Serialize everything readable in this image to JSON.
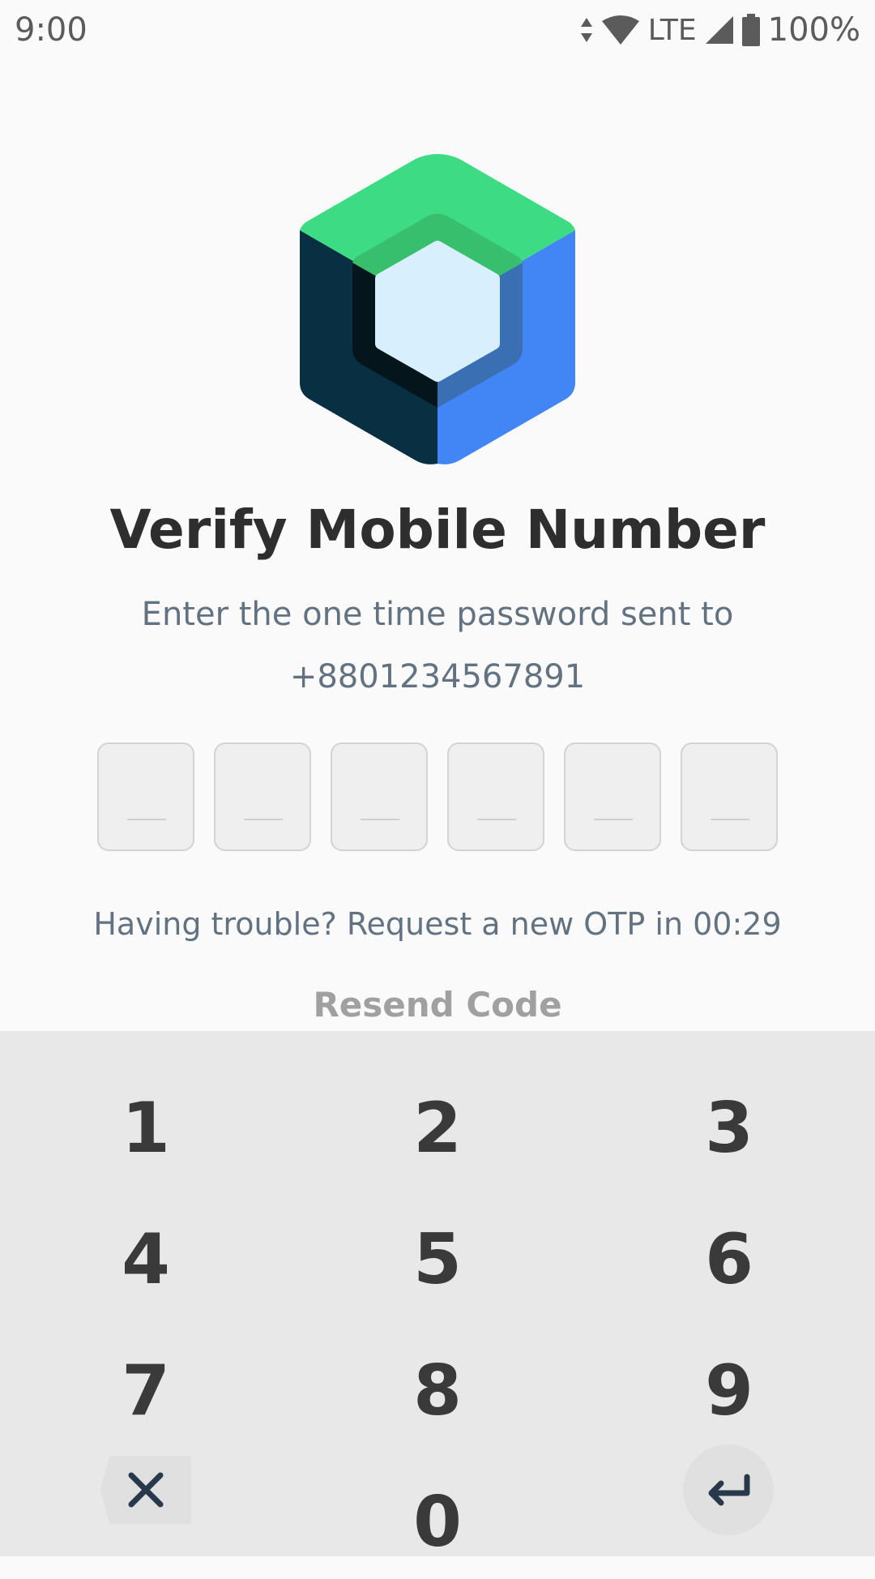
{
  "status_bar": {
    "time": "9:00",
    "network": "LTE",
    "battery": "100%",
    "icons": [
      "data-arrows-icon",
      "wifi-icon",
      "cell-signal-icon",
      "battery-icon"
    ]
  },
  "logo": {
    "icon": "jetpack-compose-logo"
  },
  "title": "Verify Mobile Number",
  "subtitle": {
    "line1": "Enter the one time password sent to",
    "line2": "+8801234567891"
  },
  "otp": {
    "digits": [
      "",
      "",
      "",
      "",
      "",
      ""
    ]
  },
  "trouble_text": "Having trouble? Request a new OTP in 00:29",
  "resend_label": "Resend Code",
  "keypad": {
    "keys": [
      "1",
      "2",
      "3",
      "4",
      "5",
      "6",
      "7",
      "8",
      "9",
      "0"
    ],
    "clear_icon": "close-icon",
    "enter_icon": "enter-icon"
  },
  "colors": {
    "background": "#fafafa",
    "keypad_background": "#e8e8e8",
    "title": "#2e2e2e",
    "subtitle": "#627281",
    "resend_disabled": "#a0a0a0",
    "logo_green": "#3ddc84",
    "logo_blue": "#4285f4",
    "logo_navy": "#083042"
  }
}
